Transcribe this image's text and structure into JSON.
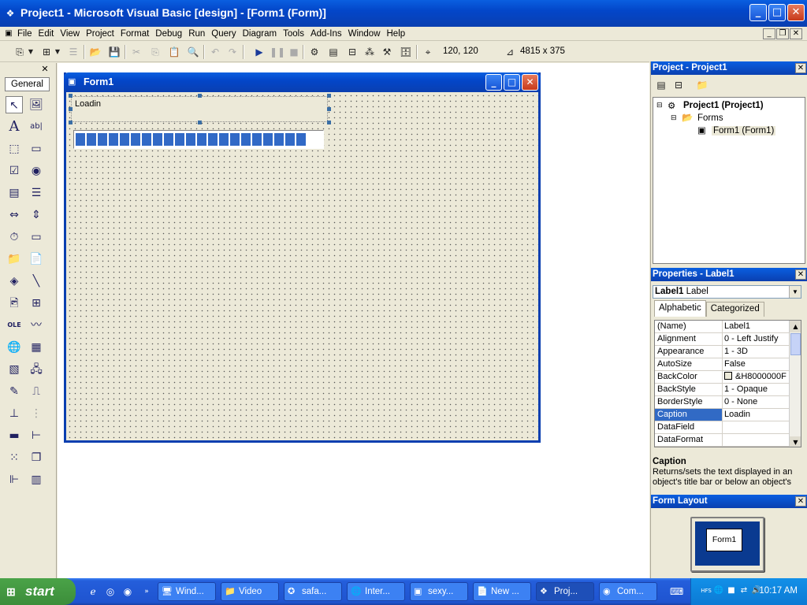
{
  "window": {
    "title": "Project1 - Microsoft Visual Basic [design] - [Form1 (Form)]",
    "min": "_",
    "max": "□",
    "close": "✕"
  },
  "menu": [
    "File",
    "Edit",
    "View",
    "Project",
    "Format",
    "Debug",
    "Run",
    "Query",
    "Diagram",
    "Tools",
    "Add-Ins",
    "Window",
    "Help"
  ],
  "toolbar": {
    "position": "120, 120",
    "size": "4815 x 375"
  },
  "toolbox": {
    "tab": "General"
  },
  "form": {
    "title": "Form1",
    "label_caption": "Loadin",
    "progress_blocks": 21
  },
  "project": {
    "title": "Project - Project1",
    "root": "Project1 (Project1)",
    "folder": "Forms",
    "item": "Form1 (Form1)"
  },
  "properties": {
    "title": "Properties - Label1",
    "object_name": "Label1",
    "object_type": "Label",
    "tabs": [
      "Alphabetic",
      "Categorized"
    ],
    "rows": [
      {
        "name": "(Name)",
        "value": "Label1"
      },
      {
        "name": "Alignment",
        "value": "0 - Left Justify"
      },
      {
        "name": "Appearance",
        "value": "1 - 3D"
      },
      {
        "name": "AutoSize",
        "value": "False"
      },
      {
        "name": "BackColor",
        "value": "&H8000000F"
      },
      {
        "name": "BackStyle",
        "value": "1 - Opaque"
      },
      {
        "name": "BorderStyle",
        "value": "0 - None"
      },
      {
        "name": "Caption",
        "value": "Loadin"
      },
      {
        "name": "DataField",
        "value": ""
      },
      {
        "name": "DataFormat",
        "value": ""
      }
    ],
    "desc_title": "Caption",
    "desc_text": "Returns/sets the text displayed in an object's title bar or below an object's"
  },
  "form_layout": {
    "title": "Form Layout",
    "form_label": "Form1"
  },
  "taskbar": {
    "start": "start",
    "tasks": [
      "Wind...",
      "Video",
      "safa...",
      "Inter...",
      "sexy...",
      "New ...",
      "Proj...",
      "Com..."
    ],
    "clock": "10:17 AM"
  }
}
